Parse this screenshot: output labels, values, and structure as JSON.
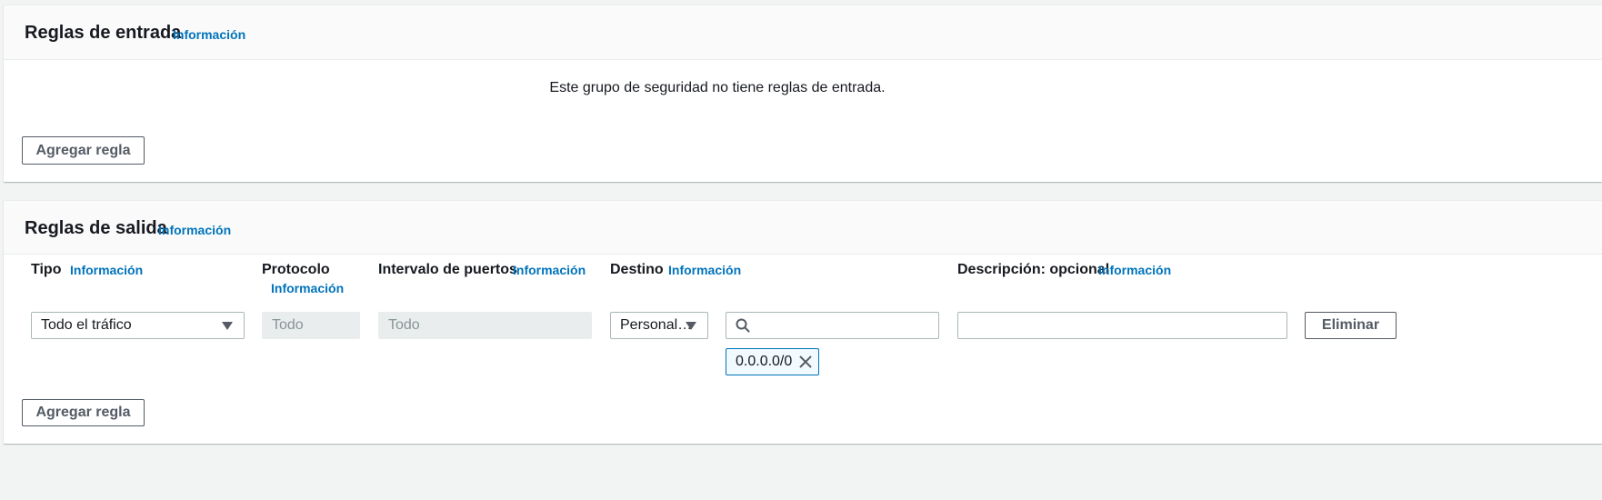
{
  "inbound": {
    "title": "Reglas de entrada",
    "info": "Información",
    "empty_message": "Este grupo de seguridad no tiene reglas de entrada.",
    "add_rule": "Agregar regla"
  },
  "outbound": {
    "title": "Reglas de salida",
    "info": "Información",
    "columns": {
      "type": {
        "label": "Tipo",
        "info": "Información"
      },
      "protocol": {
        "label": "Protocolo",
        "info": "Información"
      },
      "port_range": {
        "label": "Intervalo de puertos",
        "info": "Información"
      },
      "destination": {
        "label": "Destino",
        "info": "Información"
      },
      "description": {
        "label": "Descripción: opcional",
        "info": "Información"
      }
    },
    "row": {
      "type_value": "Todo el tráfico",
      "protocol_value": "Todo",
      "port_value": "Todo",
      "destination_type": "Personal…",
      "destination_search": "",
      "description_value": "",
      "token": "0.0.0.0/0",
      "remove": "Eliminar"
    },
    "add_rule": "Agregar regla"
  },
  "icons": {
    "search": "search-icon",
    "close": "close-icon",
    "dropdown": "caret-down-icon"
  },
  "colors": {
    "link": "#0073bb",
    "text": "#16191f",
    "button_border": "#545b64",
    "background": "#f2f3f3"
  }
}
